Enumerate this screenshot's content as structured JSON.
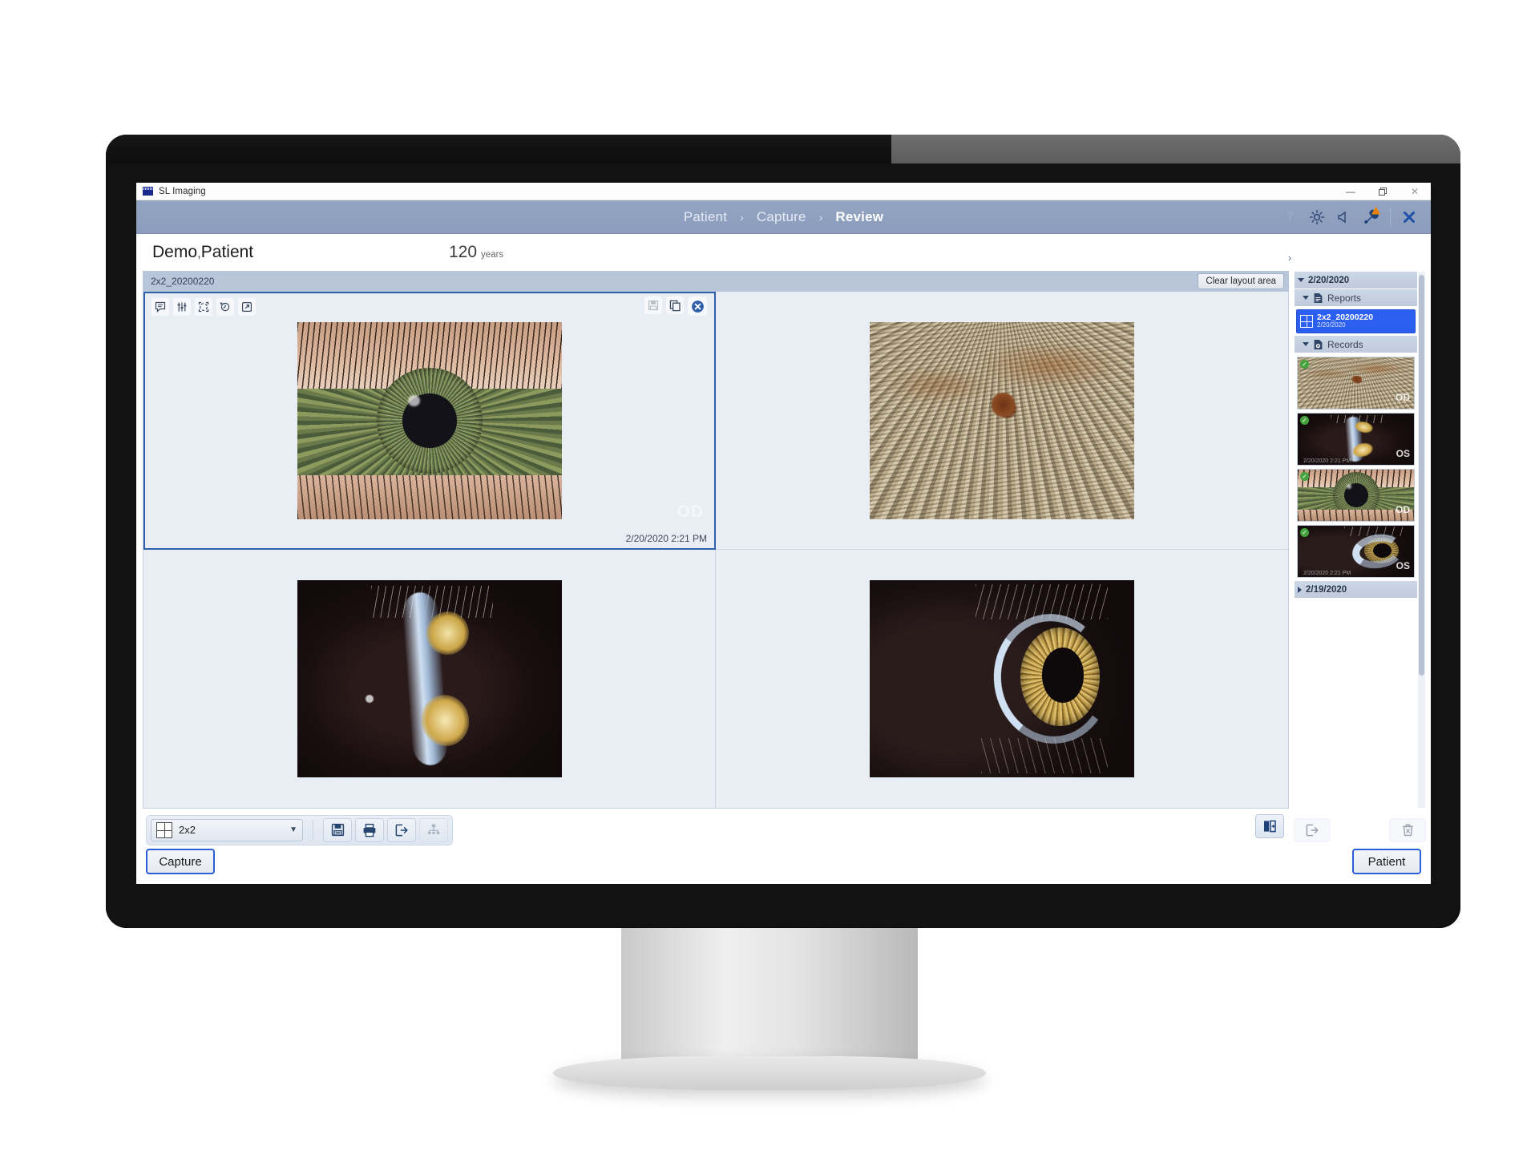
{
  "window": {
    "title": "SL Imaging",
    "app_icon": "app-window-icon",
    "controls": {
      "minimize": "—",
      "restore": "❐",
      "close": "✕"
    }
  },
  "header": {
    "breadcrumbs": [
      {
        "label": "Patient",
        "active": false
      },
      {
        "label": "Capture",
        "active": false
      },
      {
        "label": "Review",
        "active": true
      }
    ],
    "separator": "›",
    "tools": [
      {
        "name": "help-icon",
        "glyph": "?"
      },
      {
        "name": "brightness-icon",
        "glyph": "brightness"
      },
      {
        "name": "sound-icon",
        "glyph": "speaker"
      },
      {
        "name": "settings-wrench-icon",
        "glyph": "wrench",
        "warning": true
      },
      {
        "name": "close-app-icon",
        "glyph": "✕"
      }
    ],
    "accent": "#8c9dbd"
  },
  "patient": {
    "last_name": "Demo",
    "comma": ",",
    "first_name": "Patient",
    "age_value": "120",
    "age_unit": "years"
  },
  "layout_area": {
    "title": "2x2_20200220",
    "clear_button": "Clear layout area",
    "cells": [
      {
        "id": "cell-1",
        "selected": true,
        "image": "eye-anterior-od",
        "eye_label": "OD",
        "timestamp": "2/20/2020 2:21 PM",
        "toolbar_left": [
          {
            "name": "annotation-icon"
          },
          {
            "name": "image-adjust-icon"
          },
          {
            "name": "crop-transform-icon"
          },
          {
            "name": "revert-history-icon"
          },
          {
            "name": "open-external-icon"
          }
        ],
        "toolbar_right": [
          {
            "name": "save-image-icon",
            "disabled": true
          },
          {
            "name": "duplicate-image-icon",
            "disabled": false
          },
          {
            "name": "remove-image-icon",
            "disabled": false
          }
        ]
      },
      {
        "id": "cell-2",
        "selected": false,
        "image": "iris-macro",
        "eye_label": "",
        "timestamp": ""
      },
      {
        "id": "cell-3",
        "selected": false,
        "image": "slit-lamp-os",
        "eye_label": "",
        "timestamp": ""
      },
      {
        "id": "cell-4",
        "selected": false,
        "image": "slit-lamp-limbus",
        "eye_label": "",
        "timestamp": ""
      }
    ]
  },
  "bottom_toolbar": {
    "layout_select": {
      "value": "2x2",
      "icon": "grid-2x2-icon",
      "chevron": "▼"
    },
    "buttons": [
      {
        "name": "save-report-button",
        "icon": "floppy-save-icon",
        "disabled": false
      },
      {
        "name": "print-report-button",
        "icon": "printer-icon",
        "disabled": false
      },
      {
        "name": "export-report-button",
        "icon": "export-arrow-icon",
        "disabled": false
      },
      {
        "name": "network-share-button",
        "icon": "network-share-icon",
        "disabled": true
      }
    ],
    "right_buttons": [
      {
        "name": "compare-images-button",
        "icon": "compare-flip-icon",
        "disabled": false
      }
    ]
  },
  "sidebar": {
    "collapse_chevron": "›",
    "groups": [
      {
        "name": "date-group",
        "label": "2/20/2020",
        "expanded": true,
        "sections": [
          {
            "name": "reports-section",
            "label": "Reports",
            "icon": "document-icon",
            "expanded": true,
            "items": [
              {
                "name": "report-2x2",
                "title": "2x2_20200220",
                "subtitle": "2/20/2020",
                "icon": "grid-2x2-icon",
                "selected": true
              }
            ]
          },
          {
            "name": "records-section",
            "label": "Records",
            "icon": "record-image-icon",
            "expanded": true,
            "thumbnails": [
              {
                "name": "thumb-iris-macro-od",
                "image": "iris-macro",
                "label": "OD",
                "stamp": "",
                "checked": true
              },
              {
                "name": "thumb-slitlamp-os",
                "image": "slit-lamp-os",
                "label": "OS",
                "stamp": "2/20/2020 2:21 PM",
                "checked": true
              },
              {
                "name": "thumb-anterior-od",
                "image": "eye-anterior-od",
                "label": "OD",
                "stamp": "",
                "checked": true
              },
              {
                "name": "thumb-slitlamp2-os",
                "image": "slit-lamp-limbus",
                "label": "OS",
                "stamp": "2/20/2020 2:21 PM",
                "checked": true
              }
            ]
          }
        ]
      },
      {
        "name": "date-group-prev",
        "label": "2/19/2020",
        "expanded": false,
        "sections": []
      }
    ],
    "footer_buttons": [
      {
        "name": "export-record-button",
        "icon": "export-arrow-icon",
        "disabled": true
      },
      {
        "name": "delete-record-button",
        "icon": "trash-icon",
        "disabled": true
      }
    ]
  },
  "footer": {
    "capture_button": "Capture",
    "patient_button": "Patient",
    "focus_color": "#2b5fd9"
  }
}
